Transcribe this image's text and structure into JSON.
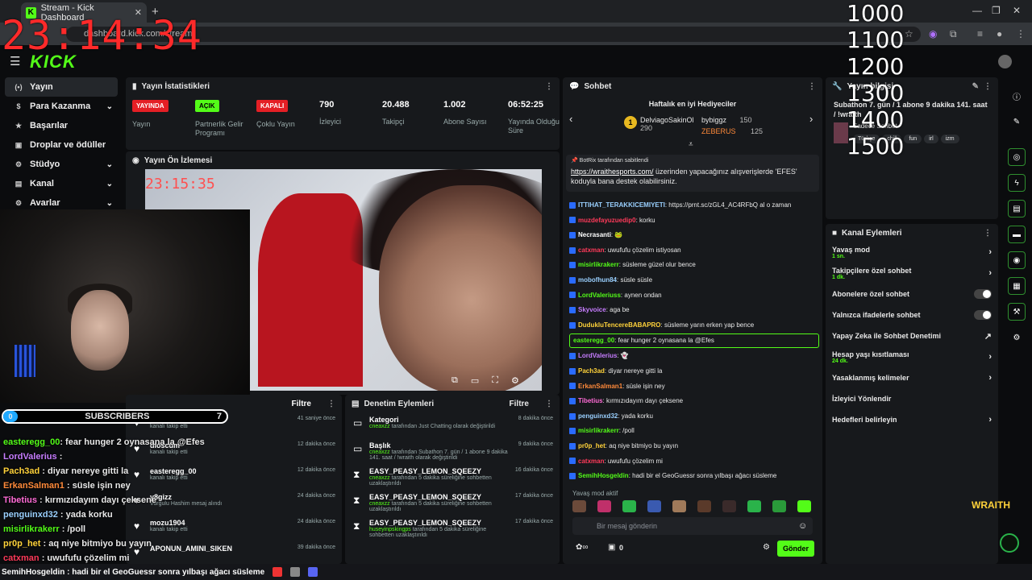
{
  "browser": {
    "tab_title": "Stream - Kick Dashboard",
    "url": "dashboard.kick.com/stream"
  },
  "overlay": {
    "clock": "23:14:34",
    "goals": [
      "1000",
      "1100",
      "1200",
      "1300",
      "1400",
      "1500"
    ],
    "subscribers_label": "SUBSCRIBERS",
    "subscribers_count": "0",
    "subscribers_goal": "7",
    "chat": [
      {
        "user": "easteregg_00",
        "text": ": fear hunger 2 oynasana la @Efes",
        "color": "#53fc18"
      },
      {
        "user": "LordValerius",
        "text": " : ",
        "color": "#c77dff"
      },
      {
        "user": "Pach3ad",
        "text": " : diyar nereye gitti la",
        "color": "#ffd23a"
      },
      {
        "user": "ErkanSalman1",
        "text": " : süsle işin ney",
        "color": "#ff8a3a"
      },
      {
        "user": "Tibetius",
        "text": " : kırmızıdayım dayı çeksene",
        "color": "#ff6bd6"
      },
      {
        "user": "penguinxd32",
        "text": " : yada korku",
        "color": "#9ad0ff"
      },
      {
        "user": "misirlikrakerr",
        "text": " : /poll",
        "color": "#53fc18"
      },
      {
        "user": "pr0p_het",
        "text": " : aq niye bitmiyo bu yayın",
        "color": "#ffd23a"
      },
      {
        "user": "catxman",
        "text": " : uwufufu çözelim mi",
        "color": "#ff3a5a"
      }
    ],
    "ticker": "SemihHosgeldin : hadi bir el GeoGuessr sonra yılbaşı ağacı süsleme",
    "wraith": "WRAITH"
  },
  "kick": {
    "logo": "KICK"
  },
  "nav": [
    {
      "label": "Yayın",
      "icon": "(•)",
      "chevron": false
    },
    {
      "label": "Para Kazanma",
      "icon": "$",
      "chevron": true
    },
    {
      "label": "Başarılar",
      "icon": "★",
      "chevron": false
    },
    {
      "label": "Droplar ve ödüller",
      "icon": "▣",
      "chevron": false
    },
    {
      "label": "Stüdyo",
      "icon": "⚙",
      "chevron": true
    },
    {
      "label": "Kanal",
      "icon": "▤",
      "chevron": true
    },
    {
      "label": "Avarlar",
      "icon": "⚙",
      "chevron": true
    }
  ],
  "stats": {
    "title": "Yayın İstatistikleri",
    "items": [
      {
        "value": "YAYINDA",
        "label": "Yayın",
        "kind": "badge-red"
      },
      {
        "value": "AÇIK",
        "label": "Partnerlik Gelir Programı",
        "kind": "badge-green"
      },
      {
        "value": "KAPALI",
        "label": "Çoklu Yayın",
        "kind": "badge-red"
      },
      {
        "value": "790",
        "label": "İzleyici",
        "kind": "num"
      },
      {
        "value": "20.488",
        "label": "Takipçi",
        "kind": "num"
      },
      {
        "value": "1.002",
        "label": "Abone Sayısı",
        "kind": "num"
      },
      {
        "value": "06:52:25",
        "label": "Yayında Olduğu Süre",
        "kind": "num"
      }
    ]
  },
  "preview": {
    "title": "Yayın Ön İzlemesi",
    "mini_clock": "23:15:35"
  },
  "followers": {
    "filter": "Filtre",
    "events": [
      {
        "name": "easteregg_00",
        "sub": "kanalı takip etti",
        "time": "41 saniye önce"
      },
      {
        "name": "dioscum",
        "sub": "kanalı takip etti",
        "time": "12 dakika önce"
      },
      {
        "name": "easteregg_00",
        "sub": "kanalı takip etti",
        "time": "12 dakika önce"
      },
      {
        "name": "y8gizz",
        "sub": "Vurgulu Hashim mesaj alındı",
        "time": "24 dakika önce"
      },
      {
        "name": "mozu1904",
        "sub": "kanalı takip etti",
        "time": "24 dakika önce"
      },
      {
        "name": "APONUN_AMINI_SIKEN",
        "sub": "",
        "time": "39 dakika önce"
      }
    ]
  },
  "moderation": {
    "title": "Denetim Eylemleri",
    "filter": "Filtre",
    "events": [
      {
        "icon": "▭",
        "title": "Kategori",
        "who": "cneaxzz",
        "sub": " tarafından Just Chatting olarak değiştirildi",
        "time": "8 dakika önce"
      },
      {
        "icon": "▭",
        "title": "Başlık",
        "who": "cneaxzz",
        "sub": " tarafından Subathon 7. gün / 1 abone 9 dakika 141. saat / !wraith olarak değiştirildi",
        "time": "9 dakika önce"
      },
      {
        "icon": "⧗",
        "title": "EASY_PEASY_LEMON_SQEEZY",
        "who": "cneaxzz",
        "sub": " tarafından 5 dakika süreliğine sohbetten uzaklaştırıldı",
        "time": "16 dakika önce"
      },
      {
        "icon": "⧗",
        "title": "EASY_PEASY_LEMON_SQEEZY",
        "who": "cneaxzz",
        "sub": " tarafından 5 dakika süreliğine sohbetten uzaklaştırıldı",
        "time": "17 dakika önce"
      },
      {
        "icon": "⧗",
        "title": "EASY_PEASY_LEMON_SQEEZY",
        "who": "huseyinpskingps",
        "sub": " tarafından 5 dakika süreliğine sohbetten uzaklaştırıldı",
        "time": "17 dakika önce"
      }
    ]
  },
  "chat": {
    "title": "Sohbet",
    "gifters_title": "Haftalık en iyi Hediyeciler",
    "gifters": [
      {
        "name": "DelviagoSakinOl",
        "count": "290"
      },
      {
        "name": "bybiggz",
        "count": "150"
      },
      {
        "name": "ZEBERUS",
        "count": "125"
      }
    ],
    "pinned_by": "BotRix tarafından sabitlendi",
    "pinned_link": "https://wraithesports.com/",
    "pinned_text": " üzerinden yapacağınız alışverişlerde 'EFES' koduyla bana destek olabilirsiniz.",
    "messages": [
      {
        "user": "ITTIHAT_TERAKKICEMIYETI",
        "text": ": https://prnt.sc/zGL4_AC4RFbQ al o zaman",
        "color": "#9ad0ff"
      },
      {
        "user": "muzdefayuzuedip0",
        "text": ": korku",
        "color": "#ff3a5a"
      },
      {
        "user": "Necrasanti",
        "text": ": 🐸",
        "color": "#fff"
      },
      {
        "user": "catxman",
        "text": ": uwufufu çözelim istiyosan",
        "color": "#ff3a5a"
      },
      {
        "user": "misirlikrakerr",
        "text": ": süsleme güzel olur bence",
        "color": "#53fc18"
      },
      {
        "user": "mobofhun84",
        "text": ": süsle süsle",
        "color": "#9ad0ff"
      },
      {
        "user": "LordValeriuss",
        "text": ": aynen ondan",
        "color": "#53fc18"
      },
      {
        "user": "Skyvoice",
        "text": ": aga be",
        "color": "#c77dff"
      },
      {
        "user": "DudukluTencereBABAPRO",
        "text": ": süsleme yarın erken yap bence",
        "color": "#ffd23a"
      },
      {
        "user": "easteregg_00",
        "text": ": fear hunger 2 oynasana la @Efes",
        "color": "#53fc18",
        "highlight": true
      },
      {
        "user": "LordValerius",
        "text": ": 👻",
        "color": "#c77dff"
      },
      {
        "user": "Pach3ad",
        "text": ": diyar nereye gitti la",
        "color": "#ffd23a"
      },
      {
        "user": "ErkanSalman1",
        "text": ": süsle işin ney",
        "color": "#ff8a3a"
      },
      {
        "user": "Tibetius",
        "text": ": kırmızıdayım dayı çeksene",
        "color": "#ff6bd6"
      },
      {
        "user": "penguinxd32",
        "text": ": yada korku",
        "color": "#9ad0ff"
      },
      {
        "user": "misirlikrakerr",
        "text": ": /poll",
        "color": "#53fc18"
      },
      {
        "user": "pr0p_het",
        "text": ": aq niye bitmiyo bu yayın",
        "color": "#ffd23a"
      },
      {
        "user": "catxman",
        "text": ": uwufufu çözelim mi",
        "color": "#ff3a5a"
      },
      {
        "user": "SemihHosgeldin",
        "text": ": hadi bir el GeoGuessr sonra yılbaşı ağacı süsleme",
        "color": "#53fc18"
      }
    ],
    "slow_mode": "Yavaş mod aktif",
    "input_placeholder": "Bir mesaj gönderin",
    "points": "0",
    "send_label": "Gönder"
  },
  "stream_info": {
    "title": "Yayın bilgisi",
    "stream_title": "Subathon 7. gün / 1 abone 9 dakika 141. saat / !wraith",
    "category": "Sadece Sohbet",
    "tags": [
      "Türkçe",
      "chill",
      "fun",
      "irl",
      "izm"
    ]
  },
  "channel_actions": {
    "title": "Kanal Eylemleri",
    "items": [
      {
        "label": "Yavaş mod",
        "sub": "1 sn.",
        "control": "chevron"
      },
      {
        "label": "Takipçilere özel sohbet",
        "sub": "1 dk.",
        "control": "chevron"
      },
      {
        "label": "Abonelere özel sohbet",
        "sub": "",
        "control": "toggle"
      },
      {
        "label": "Yalnızca ifadelerle sohbet",
        "sub": "",
        "control": "toggle"
      },
      {
        "label": "Yapay Zeka ile Sohbet Denetimi",
        "sub": "",
        "control": "external"
      },
      {
        "label": "Hesap yaşı kısıtlaması",
        "sub": "24 dk.",
        "control": "chevron"
      },
      {
        "label": "Yasaklanmış kelimeler",
        "sub": "",
        "control": "chevron"
      },
      {
        "label": "İzleyici Yönlendir",
        "sub": "",
        "control": "none"
      },
      {
        "label": "Hedefleri belirleyin",
        "sub": "",
        "control": "chevron"
      }
    ]
  }
}
